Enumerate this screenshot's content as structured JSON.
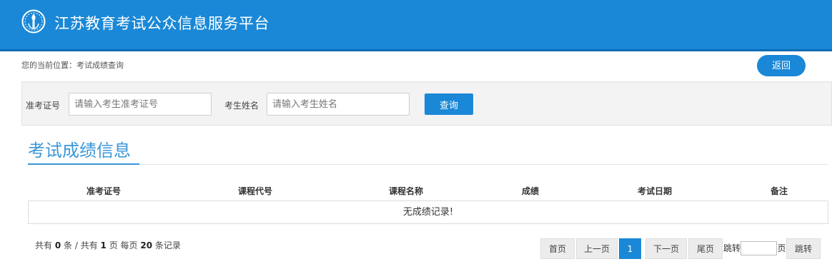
{
  "header": {
    "title": "江苏教育考试公众信息服务平台",
    "logo_icon": "torch-emblem-icon",
    "brand_color": "#1a88d6"
  },
  "breadcrumb": {
    "text": "您的当前位置：考试成绩查询"
  },
  "back_button": {
    "label": "返回"
  },
  "search": {
    "ticket_label": "准考证号",
    "ticket_placeholder": "请输入考生准考证号",
    "ticket_value": "",
    "name_label": "考生姓名",
    "name_placeholder": "请输入考生姓名",
    "name_value": "",
    "query_label": "查询"
  },
  "section": {
    "title": "考试成绩信息"
  },
  "table": {
    "columns": [
      "准考证号",
      "课程代号",
      "课程名称",
      "成绩",
      "考试日期",
      "备注"
    ],
    "empty_text": "无成绩记录!"
  },
  "footer": {
    "summary": {
      "prefix": "共有",
      "total_records": "0",
      "mid1": "条 / 共有",
      "total_pages": "1",
      "mid2": "页 每页",
      "per_page": "20",
      "suffix": "条记录"
    }
  },
  "pagination": {
    "first": "首页",
    "prev": "上一页",
    "current": "1",
    "next": "下一页",
    "last": "尾页",
    "jump_label": "跳转",
    "jump_value": "",
    "page_label": "页",
    "go": "跳转"
  }
}
